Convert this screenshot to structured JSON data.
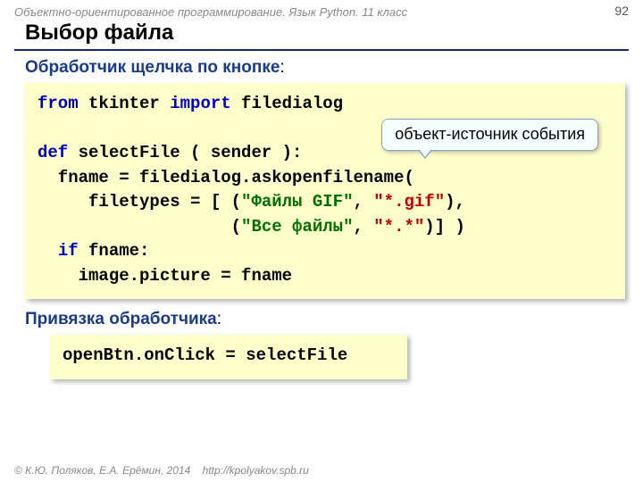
{
  "header_context": "Объектно-ориентированное программирование. Язык Python. 11 класс",
  "page_number": "92",
  "title": "Выбор файла",
  "section1_label": "Обработчик щелчка по кнопке",
  "callout": "объект-источник события",
  "code1": {
    "l1a": "from",
    "l1b": " tkinter ",
    "l1c": "import",
    "l1d": " filedialog",
    "l2": "",
    "l3a": "def",
    "l3b": " selectFile ( sender ):",
    "l4": "  fname = filedialog.askopenfilename(",
    "l5a": "     filetypes = [ (",
    "l5b": "\"Файлы GIF\"",
    "l5c": ", ",
    "l5d": "\"*.gif\"",
    "l5e": "),",
    "l6a": "                   (",
    "l6b": "\"Все файлы\"",
    "l6c": ", ",
    "l6d": "\"*.*\"",
    "l6e": ")] )",
    "l7a": "  ",
    "l7b": "if",
    "l7c": " fname:",
    "l8": "    image.picture = fname"
  },
  "section2_label": "Привязка обработчика",
  "code2": "openBtn.onClick = selectFile",
  "footer_authors": "© К.Ю. Поляков, Е.А. Ерёмин, 2014",
  "footer_url": "http://kpolyakov.spb.ru"
}
